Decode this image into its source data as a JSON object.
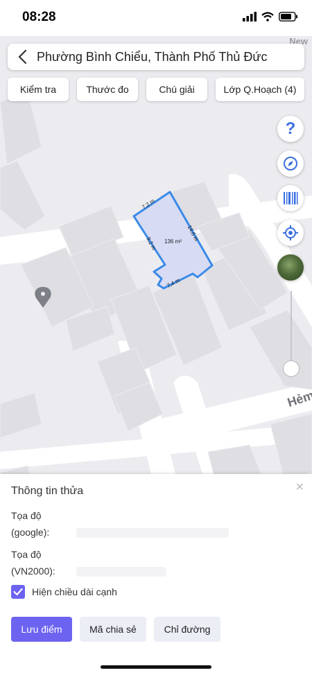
{
  "status": {
    "time": "08:28"
  },
  "map": {
    "new_label": "New",
    "street_label": "Hẻm",
    "parcel": {
      "area": "136 m²",
      "edges": [
        "7,2 m",
        "14,6 m",
        "7,4 m",
        "9,2 m"
      ]
    }
  },
  "header": {
    "title": "Phường Bình Chiểu, Thành Phố Thủ Đức"
  },
  "chips": [
    "Kiểm tra",
    "Thước đo",
    "Chú giải",
    "Lớp Q.Hoạch (4)"
  ],
  "fabs": {
    "help": "?",
    "icons": [
      "compass-icon",
      "barcode-icon",
      "locate-icon",
      "satellite-layer-icon"
    ]
  },
  "sheet": {
    "title": "Thông tin thửa",
    "coord_google_label_1": "Tọa độ",
    "coord_google_label_2": "(google):",
    "coord_vn2000_label_1": "Tọa độ",
    "coord_vn2000_label_2": "(VN2000):",
    "checkbox_label": "Hiện chiều dài cạnh",
    "checkbox_checked": true,
    "save_button": "Lưu điểm",
    "share_button": "Mã chia sẻ",
    "directions_button": "Chỉ đường",
    "close": "×"
  },
  "colors": {
    "accent": "#6c63f0",
    "parcel": "#3a8ae8"
  }
}
